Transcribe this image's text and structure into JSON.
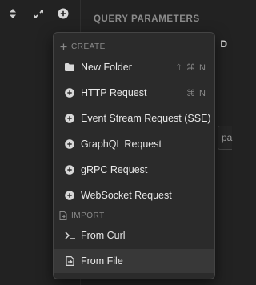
{
  "toolbar": {
    "icons": [
      "sort-arrows-icon",
      "expand-icon",
      "add-circle-icon"
    ]
  },
  "right_pane": {
    "section_title": "QUERY PARAMETERS",
    "clipped_heading": "D",
    "clipped_input_text": "pa"
  },
  "menu": {
    "create_header": "CREATE",
    "import_header": "IMPORT",
    "items": [
      {
        "label": "New Folder",
        "shortcut": "⇧ ⌘ N",
        "icon": "folder-icon"
      },
      {
        "label": "HTTP Request",
        "shortcut": "⌘ N",
        "icon": "add-circle-icon"
      },
      {
        "label": "Event Stream Request (SSE)",
        "shortcut": "",
        "icon": "add-circle-icon"
      },
      {
        "label": "GraphQL Request",
        "shortcut": "",
        "icon": "add-circle-icon"
      },
      {
        "label": "gRPC Request",
        "shortcut": "",
        "icon": "add-circle-icon"
      },
      {
        "label": "WebSocket Request",
        "shortcut": "",
        "icon": "add-circle-icon"
      }
    ],
    "import_items": [
      {
        "label": "From Curl",
        "icon": "terminal-prompt-icon"
      },
      {
        "label": "From File",
        "icon": "file-import-icon"
      }
    ]
  },
  "colors": {
    "background": "#222222",
    "menu_background": "#2b2b2b",
    "highlight": "#383838",
    "text": "#e8e8e8",
    "muted": "#8a8a8a"
  }
}
